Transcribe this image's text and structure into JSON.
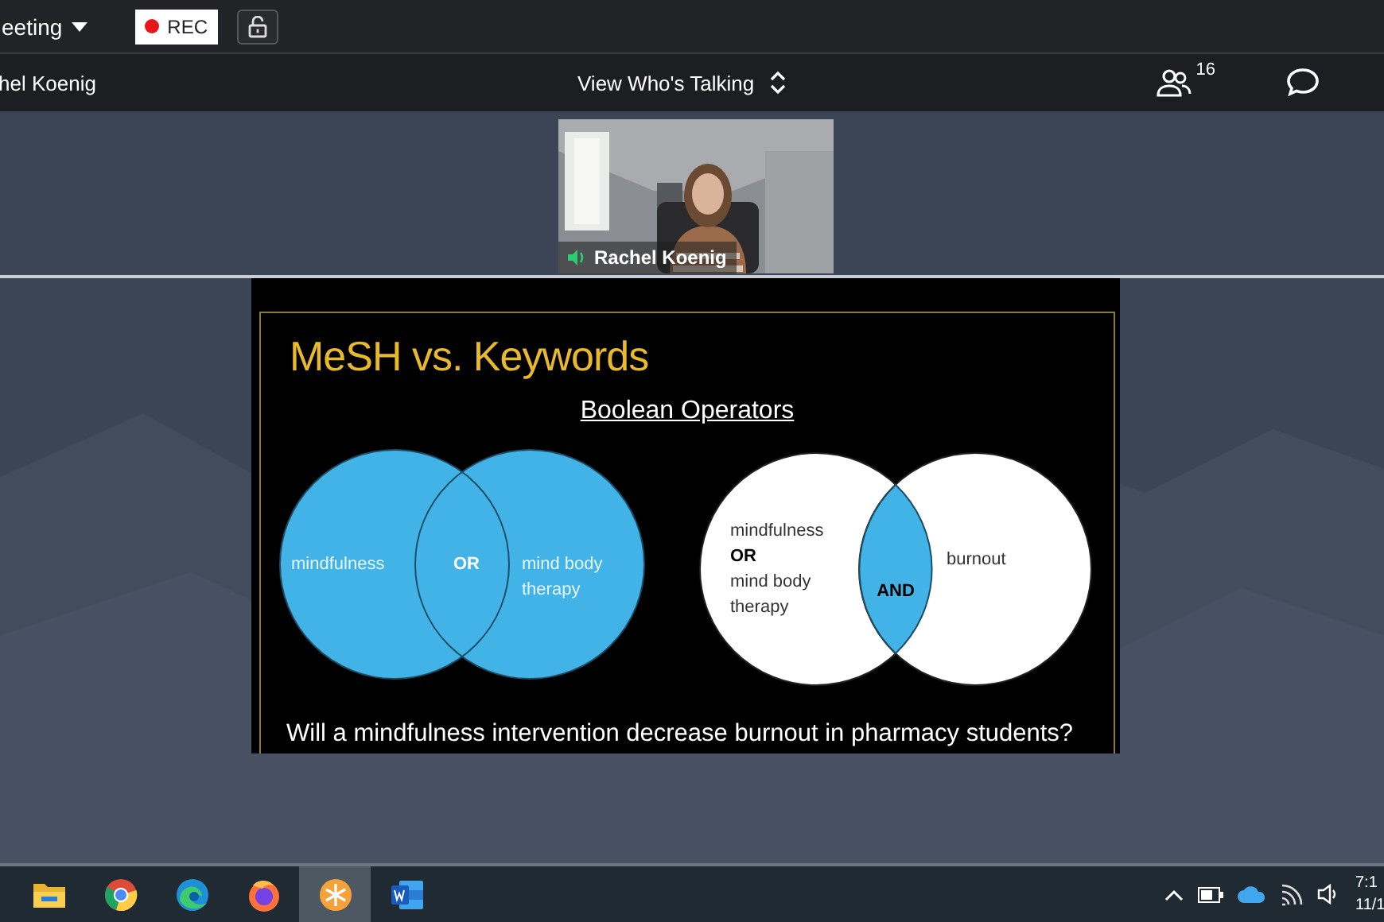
{
  "meeting_bar": {
    "title": "eeting",
    "rec_label": "REC"
  },
  "view_bar": {
    "speaker": "hel Koenig",
    "view_mode": "View Who's Talking",
    "participant_count": "16"
  },
  "video_tile": {
    "kind": "picture",
    "name": "Rachel Koenig"
  },
  "slide": {
    "title": "MeSH vs. Keywords",
    "subtitle": "Boolean Operators",
    "or_diagram": {
      "left": "mindfulness",
      "operator": "OR",
      "right": [
        "mind body",
        "therapy"
      ]
    },
    "and_diagram": {
      "left": [
        {
          "text": "mindfulness",
          "kind": "term"
        },
        {
          "text": "OR",
          "kind": "operator"
        },
        {
          "text": "mind body",
          "kind": "term"
        },
        {
          "text": "therapy",
          "kind": "term"
        }
      ],
      "operator": "AND",
      "right": "burnout"
    },
    "question": "Will a mindfulness intervention decrease burnout in pharmacy students?"
  },
  "taskbar": {
    "apps": [
      {
        "kind": "folder",
        "selected": false
      },
      {
        "kind": "chrome",
        "selected": false
      },
      {
        "kind": "edge",
        "selected": false
      },
      {
        "kind": "firefox",
        "selected": false
      },
      {
        "kind": "snowflake",
        "selected": true
      },
      {
        "kind": "word",
        "selected": false
      }
    ],
    "time": "7:1",
    "date": "11/1"
  }
}
